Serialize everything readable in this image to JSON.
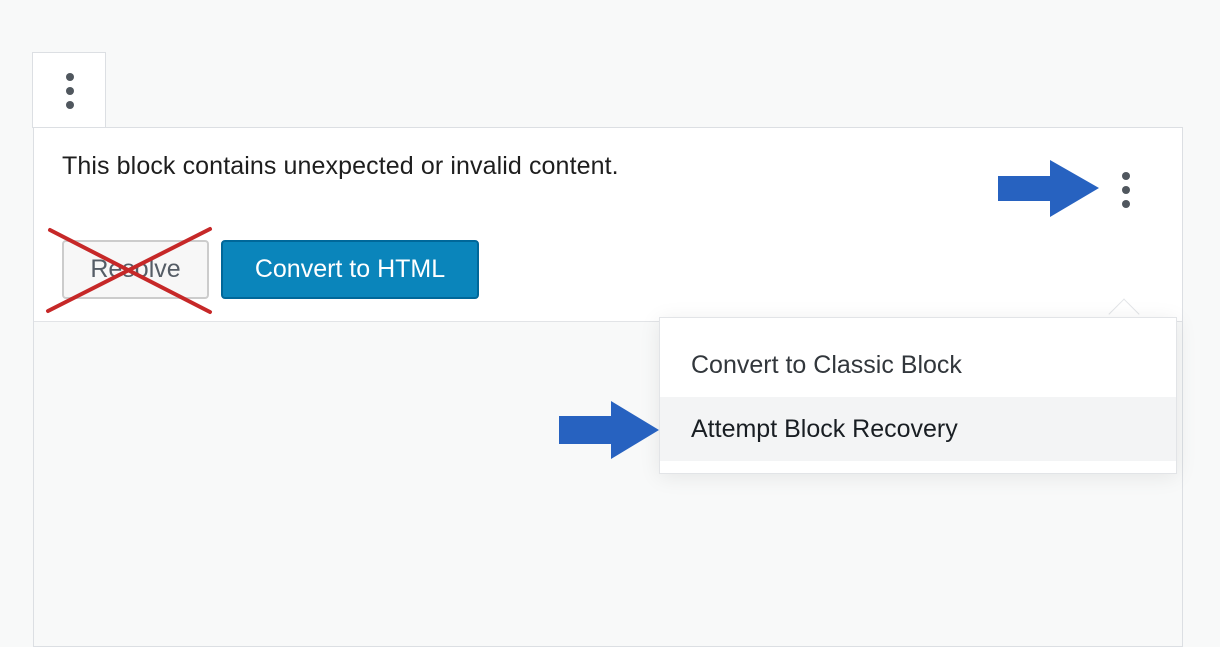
{
  "warning": {
    "message": "This block contains unexpected or invalid content."
  },
  "buttons": {
    "resolve_label": "Resolve",
    "convert_label": "Convert to HTML"
  },
  "menu": {
    "items": [
      {
        "label": "Convert to Classic Block"
      },
      {
        "label": "Attempt Block Recovery",
        "highlighted": true
      }
    ]
  },
  "annotations": {
    "arrow_color": "#2762c0",
    "cross_color": "#c62828"
  },
  "colors": {
    "primary_button": "#0a85bb",
    "icon": "#50575e"
  }
}
